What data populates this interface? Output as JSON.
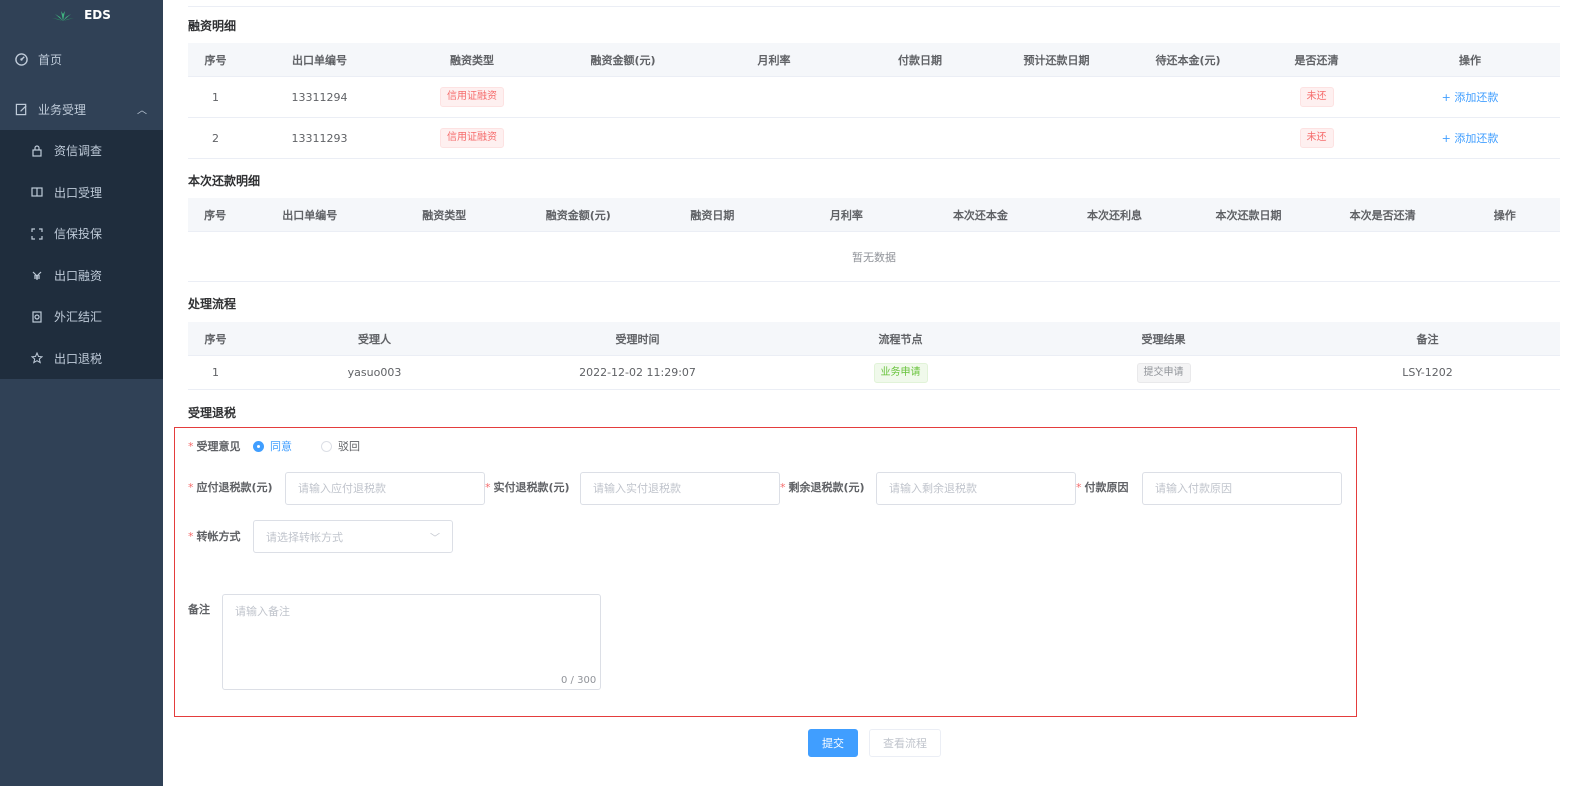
{
  "sidebar": {
    "logo_text": "EDS",
    "home": "首页",
    "group": "业务受理",
    "items": [
      {
        "label": "资信调查",
        "icon": "lock-icon"
      },
      {
        "label": "出口受理",
        "icon": "book-icon"
      },
      {
        "label": "信保投保",
        "icon": "expand-icon"
      },
      {
        "label": "出口融资",
        "icon": "money-icon"
      },
      {
        "label": "外汇结汇",
        "icon": "exchange-icon"
      },
      {
        "label": "出口退税",
        "icon": "star-icon"
      }
    ]
  },
  "financing": {
    "title": "融资明细",
    "headers": [
      "序号",
      "出口单编号",
      "融资类型",
      "融资金额(元)",
      "月利率",
      "付款日期",
      "预计还款日期",
      "待还本金(元)",
      "是否还清",
      "操作"
    ],
    "rows": [
      {
        "no": "1",
        "order": "13311294",
        "type": "信用证融资",
        "amount": "",
        "rate": "",
        "pay_date": "",
        "due_date": "",
        "principal": "",
        "status": "未还",
        "action": "添加还款"
      },
      {
        "no": "2",
        "order": "13311293",
        "type": "信用证融资",
        "amount": "",
        "rate": "",
        "pay_date": "",
        "due_date": "",
        "principal": "",
        "status": "未还",
        "action": "添加还款"
      }
    ]
  },
  "repayment": {
    "title": "本次还款明细",
    "headers": [
      "序号",
      "出口单编号",
      "融资类型",
      "融资金额(元)",
      "融资日期",
      "月利率",
      "本次还本金",
      "本次还利息",
      "本次还款日期",
      "本次是否还清",
      "操作"
    ],
    "empty_text": "暂无数据"
  },
  "process": {
    "title": "处理流程",
    "headers": [
      "序号",
      "受理人",
      "受理时间",
      "流程节点",
      "受理结果",
      "备注"
    ],
    "rows": [
      {
        "no": "1",
        "handler": "yasuo003",
        "time": "2022-12-02 11:29:07",
        "node": "业务申请",
        "result": "提交申请",
        "remark": "LSY-1202"
      }
    ]
  },
  "form": {
    "title": "受理退税",
    "opinion_label": "受理意见",
    "agree": "同意",
    "reject": "驳回",
    "payable_label": "应付退税款(元)",
    "payable_placeholder": "请输入应付退税款",
    "actual_label": "实付退税款(元)",
    "actual_placeholder": "请输入实付退税款",
    "remaining_label": "剩余退税款(元)",
    "remaining_placeholder": "请输入剩余退税款",
    "reason_label": "付款原因",
    "reason_placeholder": "请输入付款原因",
    "transfer_label": "转帐方式",
    "transfer_placeholder": "请选择转帐方式",
    "remark_label": "备注",
    "remark_placeholder": "请输入备注",
    "remark_count": "0 / 300"
  },
  "actions": {
    "submit": "提交",
    "view_flow": "查看流程"
  },
  "colors": {
    "sidebar_bg": "#304156",
    "submenu_bg": "#1f2d3d",
    "primary": "#409eff",
    "danger": "#f56c6c",
    "success": "#67c23a",
    "form_border": "#e43d3d"
  }
}
